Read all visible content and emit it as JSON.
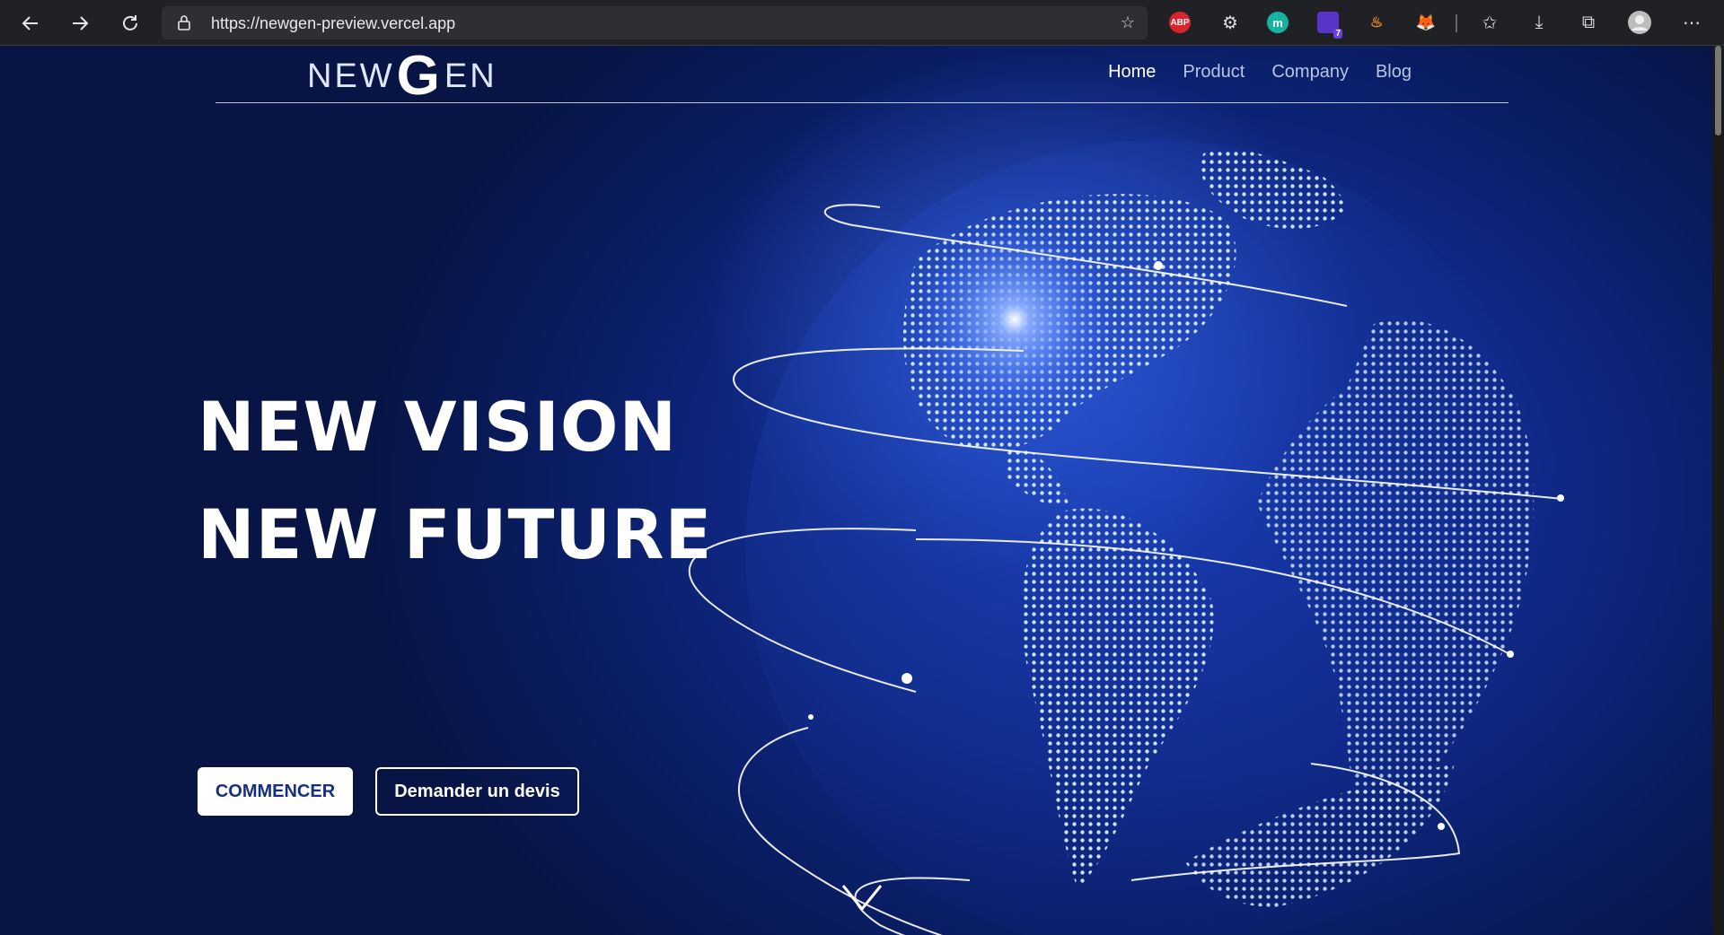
{
  "browser": {
    "url": "https://newgen-preview.vercel.app",
    "icons": [
      "back-icon",
      "forward-icon",
      "refresh-icon",
      "lock-icon",
      "add-favorite-icon",
      "adblock-icon",
      "settings-extension-icon",
      "m-extension-icon",
      "purple-extension-icon",
      "orange-extension-icon",
      "fox-extension-icon",
      "favorites-icon",
      "download-icon",
      "collections-icon",
      "profile-icon",
      "more-icon"
    ],
    "ext_badges": {
      "adblock": "ABP",
      "m": "m",
      "purple_count": "7"
    }
  },
  "site": {
    "logo": {
      "prefix": "NEW",
      "g": "G",
      "suffix": "EN"
    },
    "nav": [
      {
        "label": "Home",
        "active": true
      },
      {
        "label": "Product",
        "active": false
      },
      {
        "label": "Company",
        "active": false
      },
      {
        "label": "Blog",
        "active": false
      }
    ],
    "hero": {
      "line1": "NEW VISION",
      "line2": "NEW FUTURE",
      "primary_cta": "COMMENCER",
      "secondary_cta": "Demander un devis"
    },
    "colors": {
      "background": "#0f2a8a",
      "accent_glow": "#4a78ff",
      "button_text": "#17307d",
      "dots": "#cfe6ff"
    }
  }
}
